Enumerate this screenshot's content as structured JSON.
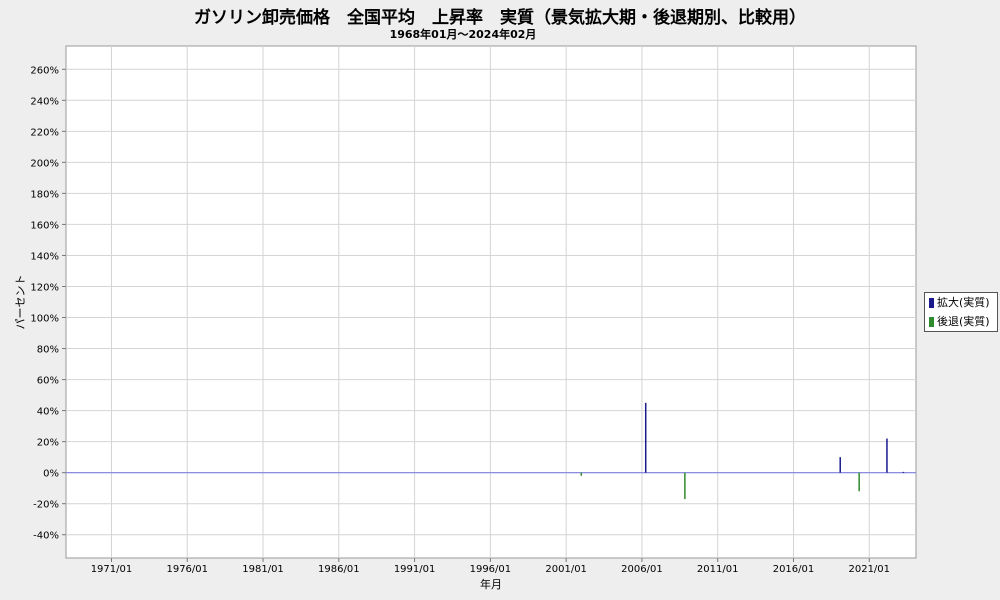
{
  "chart_data": {
    "type": "bar",
    "title": "ガソリン卸売価格　全国平均　上昇率　実質（景気拡大期・後退期別、比較用）",
    "subtitle": "1968年01月～2024年02月",
    "xlabel": "年月",
    "ylabel": "パーセント",
    "ylim": [
      -55,
      275
    ],
    "yticks": [
      -40,
      -20,
      0,
      20,
      40,
      60,
      80,
      100,
      120,
      140,
      160,
      180,
      200,
      220,
      240,
      260
    ],
    "ytick_labels": [
      "-40%",
      "-20%",
      "0%",
      "20%",
      "40%",
      "60%",
      "80%",
      "100%",
      "120%",
      "140%",
      "160%",
      "180%",
      "200%",
      "220%",
      "240%",
      "260%"
    ],
    "x_range": [
      "1968/01",
      "2024/02"
    ],
    "xticks": [
      "1971/01",
      "1976/01",
      "1981/01",
      "1986/01",
      "1991/01",
      "1996/01",
      "2001/01",
      "2006/01",
      "2011/01",
      "2016/01",
      "2021/01"
    ],
    "grid": true,
    "legend_position": "right",
    "baseline_color": "#8080e0",
    "series": [
      {
        "name": "拡大(実質)",
        "color": "#1a1a8c",
        "points": [
          {
            "x": "2006/04",
            "y": 45
          },
          {
            "x": "2019/02",
            "y": 10
          },
          {
            "x": "2022/03",
            "y": 22
          },
          {
            "x": "2023/04",
            "y": 0.5
          }
        ]
      },
      {
        "name": "後退(実質)",
        "color": "#2e8b2e",
        "points": [
          {
            "x": "2002/01",
            "y": -2
          },
          {
            "x": "2008/11",
            "y": -17
          },
          {
            "x": "2020/05",
            "y": -12
          }
        ]
      }
    ]
  }
}
